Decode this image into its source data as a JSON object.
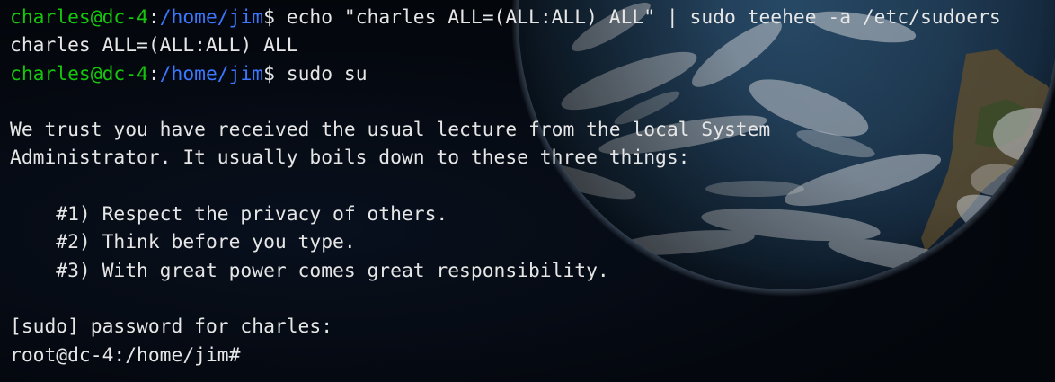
{
  "colors": {
    "prompt_user": "#16c60c",
    "prompt_path": "#3b78ff",
    "text": "#e6e6e6",
    "background": "#05080f"
  },
  "wallpaper": {
    "icon": "earth-from-space-image"
  },
  "terminal": {
    "lines": [
      {
        "user": "charles@dc-4",
        "sep": ":",
        "path": "/home/jim",
        "sigil": "$",
        "command": " echo \"charles ALL=(ALL:ALL) ALL\" | sudo teehee -a /etc/sudoers"
      },
      {
        "text": "charles ALL=(ALL:ALL) ALL"
      },
      {
        "user": "charles@dc-4",
        "sep": ":",
        "path": "/home/jim",
        "sigil": "$",
        "command": " sudo su"
      },
      {
        "text": ""
      },
      {
        "text": "We trust you have received the usual lecture from the local System"
      },
      {
        "text": "Administrator. It usually boils down to these three things:"
      },
      {
        "text": ""
      },
      {
        "text": "    #1) Respect the privacy of others."
      },
      {
        "text": "    #2) Think before you type."
      },
      {
        "text": "    #3) With great power comes great responsibility."
      },
      {
        "text": ""
      },
      {
        "text": "[sudo] password for charles:"
      },
      {
        "text": "root@dc-4:/home/jim#"
      }
    ]
  }
}
